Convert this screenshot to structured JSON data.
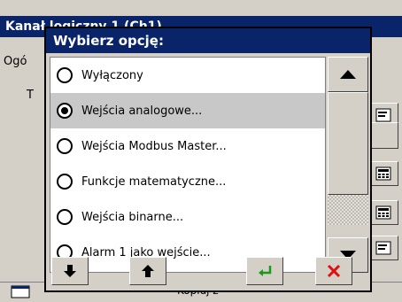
{
  "background_window": {
    "title": "Kanał logiczny 1 (Ch1)",
    "tab_label": "Ogó",
    "label_t": "T",
    "bottom_label": "Kopiuj z"
  },
  "dialog": {
    "title": "Wybierz opcję:",
    "options": [
      {
        "label": "Wyłączony",
        "checked": false
      },
      {
        "label": "Wejścia analogowe...",
        "checked": true
      },
      {
        "label": "Wejścia Modbus Master...",
        "checked": false
      },
      {
        "label": "Funkcje matematyczne...",
        "checked": false
      },
      {
        "label": "Wejścia binarne...",
        "checked": false
      },
      {
        "label": "Alarm 1 jako wejście...",
        "checked": false
      }
    ],
    "buttons": [
      "move-down",
      "move-up",
      "ok",
      "cancel"
    ]
  },
  "colors": {
    "title_bar": "#0a246a",
    "dialog_face": "#d4d0c8",
    "selected_row": "#c8c8c8",
    "ok_icon": "#1a9a1a",
    "cancel_icon": "#e01010"
  }
}
